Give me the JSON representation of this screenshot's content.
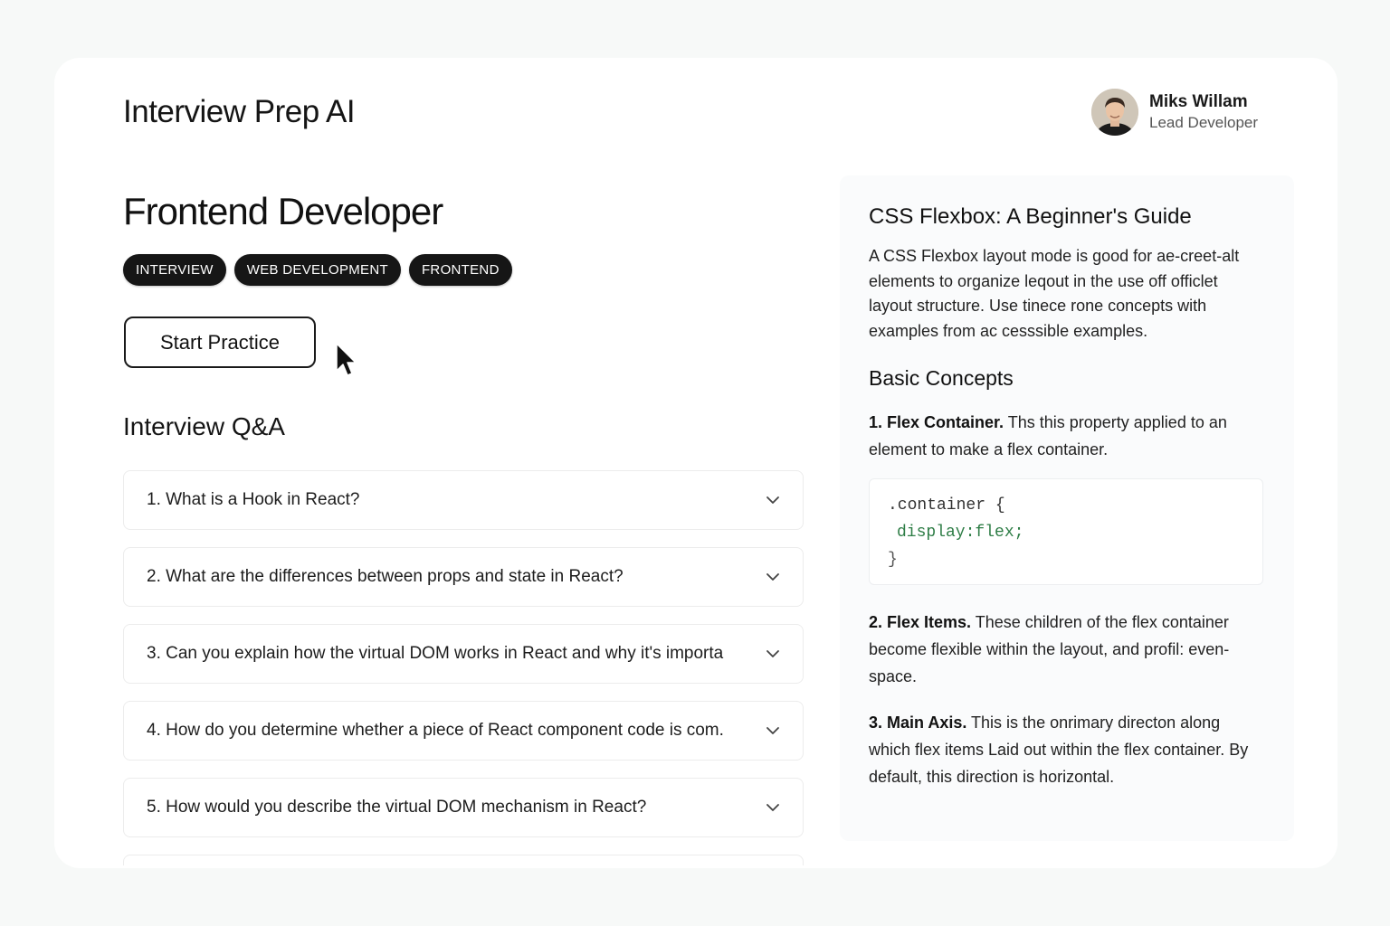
{
  "app": {
    "title": "Interview Prep AI"
  },
  "user": {
    "name": "Miks Willam",
    "role": "Lead Developer"
  },
  "page": {
    "title": "Frontend Developer",
    "tags": [
      "INTERVIEW",
      "WEB DEVELOPMENT",
      "FRONTEND"
    ],
    "start_button": "Start Practice"
  },
  "qa": {
    "title": "Interview Q&A",
    "items": [
      "1. What is a Hook in React?",
      "2. What are the differences between props and state in React?",
      "3. Can you explain how the virtual DOM works in React and why it's importa",
      "4. How do you determine whether a piece of React component code is com.",
      "5. How would you describe the virtual DOM mechanism in React?"
    ]
  },
  "guide": {
    "title": "CSS Flexbox: A Beginner's Guide",
    "intro": "A CSS Flexbox layout mode is good for ae-creet-alt elements to organize leqout in the use off officlet layout structure. Use tinece rone concepts with examples from ac cesssible examples.",
    "subtitle": "Basic Concepts",
    "concepts": [
      {
        "term": "1. Flex Container.",
        "text": " Ths this property applied to an element to make a flex container."
      },
      {
        "term": "2. Flex Items.",
        "text": " These children of the flex container become flexible within the layout, and profil: even-space."
      },
      {
        "term": "3. Main Axis.",
        "text": " This is the onrimary directon along which flex items Laid out within the flex container. By default, this direction is horizontal."
      }
    ],
    "code": [
      ".container {",
      "display:flex;",
      "}"
    ]
  },
  "icons": {
    "chevron": "chevron-down-icon",
    "cursor": "mouse-pointer-icon",
    "avatar": "user-avatar"
  },
  "colors": {
    "tag_bg": "#161616",
    "code_property": "#2e7d46",
    "page_bg": "#f7f9f8"
  }
}
